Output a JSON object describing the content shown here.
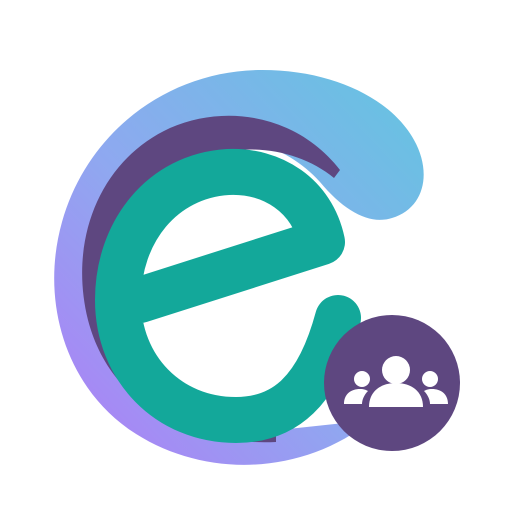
{
  "icon": {
    "name": "app-logo-e-group",
    "colors": {
      "background": "#ffffff",
      "arc_gradient_start": "#b07cf6",
      "arc_gradient_mid": "#8fa8f0",
      "arc_gradient_end": "#63c5e0",
      "shadow_purple": "#5e4780",
      "letter_teal": "#13a89a",
      "badge_purple": "#5e4780",
      "badge_glyph": "#ffffff"
    },
    "badge": {
      "icon_name": "users-group-icon"
    }
  }
}
